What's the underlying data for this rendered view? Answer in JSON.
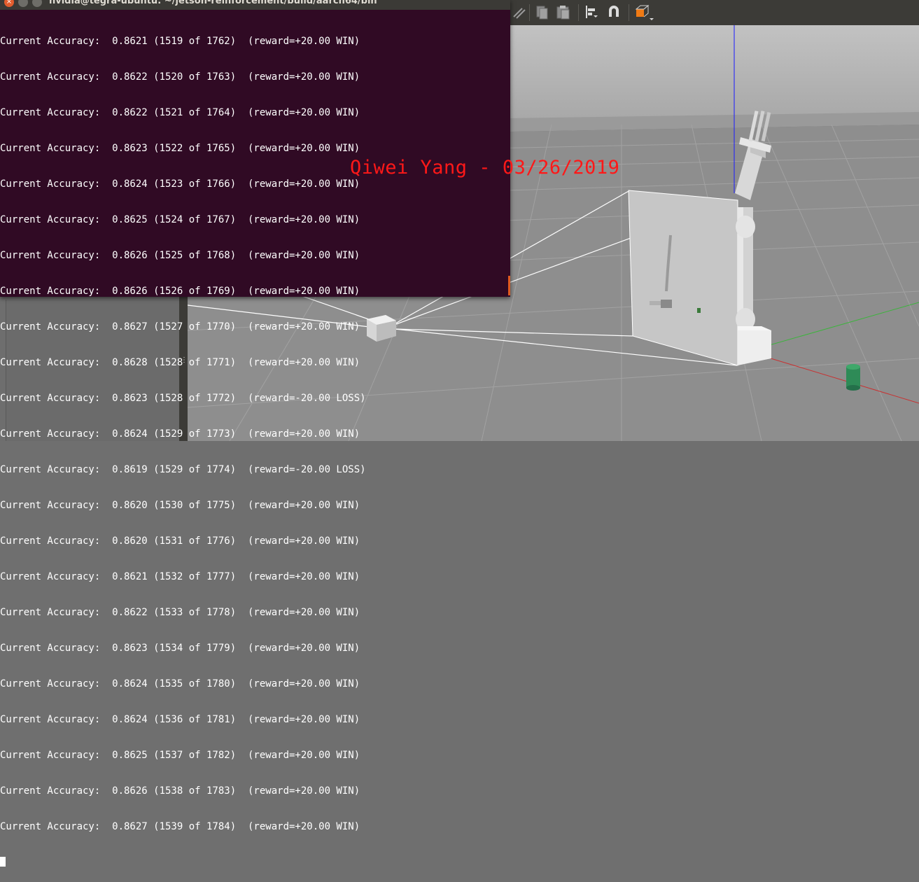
{
  "terminal": {
    "title": "nvidia@tegra-ubuntu: ~/jetson-reinforcement/build/aarch64/bin",
    "close_glyph": "×",
    "lines": [
      "Current Accuracy:  0.8621 (1519 of 1762)  (reward=+20.00 WIN)",
      "Current Accuracy:  0.8622 (1520 of 1763)  (reward=+20.00 WIN)",
      "Current Accuracy:  0.8622 (1521 of 1764)  (reward=+20.00 WIN)",
      "Current Accuracy:  0.8623 (1522 of 1765)  (reward=+20.00 WIN)",
      "Current Accuracy:  0.8624 (1523 of 1766)  (reward=+20.00 WIN)",
      "Current Accuracy:  0.8625 (1524 of 1767)  (reward=+20.00 WIN)",
      "Current Accuracy:  0.8626 (1525 of 1768)  (reward=+20.00 WIN)",
      "Current Accuracy:  0.8626 (1526 of 1769)  (reward=+20.00 WIN)",
      "Current Accuracy:  0.8627 (1527 of 1770)  (reward=+20.00 WIN)",
      "Current Accuracy:  0.8628 (1528 of 1771)  (reward=+20.00 WIN)",
      "Current Accuracy:  0.8623 (1528 of 1772)  (reward=-20.00 LOSS)",
      "Current Accuracy:  0.8624 (1529 of 1773)  (reward=+20.00 WIN)",
      "Current Accuracy:  0.8619 (1529 of 1774)  (reward=-20.00 LOSS)",
      "Current Accuracy:  0.8620 (1530 of 1775)  (reward=+20.00 WIN)",
      "Current Accuracy:  0.8620 (1531 of 1776)  (reward=+20.00 WIN)",
      "Current Accuracy:  0.8621 (1532 of 1777)  (reward=+20.00 WIN)",
      "Current Accuracy:  0.8622 (1533 of 1778)  (reward=+20.00 WIN)",
      "Current Accuracy:  0.8623 (1534 of 1779)  (reward=+20.00 WIN)",
      "Current Accuracy:  0.8624 (1535 of 1780)  (reward=+20.00 WIN)",
      "Current Accuracy:  0.8624 (1536 of 1781)  (reward=+20.00 WIN)",
      "Current Accuracy:  0.8625 (1537 of 1782)  (reward=+20.00 WIN)",
      "Current Accuracy:  0.8626 (1538 of 1783)  (reward=+20.00 WIN)",
      "Current Accuracy:  0.8627 (1539 of 1784)  (reward=+20.00 WIN)"
    ]
  },
  "watermark": "Qiwei Yang - 03/26/2019",
  "toolbar": {
    "icons": [
      "line-tool-icon",
      "copy-icon",
      "paste-icon",
      "align-icon",
      "magnet-snap-icon",
      "view-angle-icon"
    ]
  },
  "splitter_grip": "⋮",
  "colors": {
    "terminal_bg": "#300a24",
    "terminal_text": "#ffffff",
    "watermark": "#ff1818",
    "viewport_sky": "#b4b4b4",
    "ground": "#8e8e8e",
    "camera_frustum": "#ffffff",
    "target_cylinder": "#2e8b57",
    "accent": "#e05a1f"
  }
}
